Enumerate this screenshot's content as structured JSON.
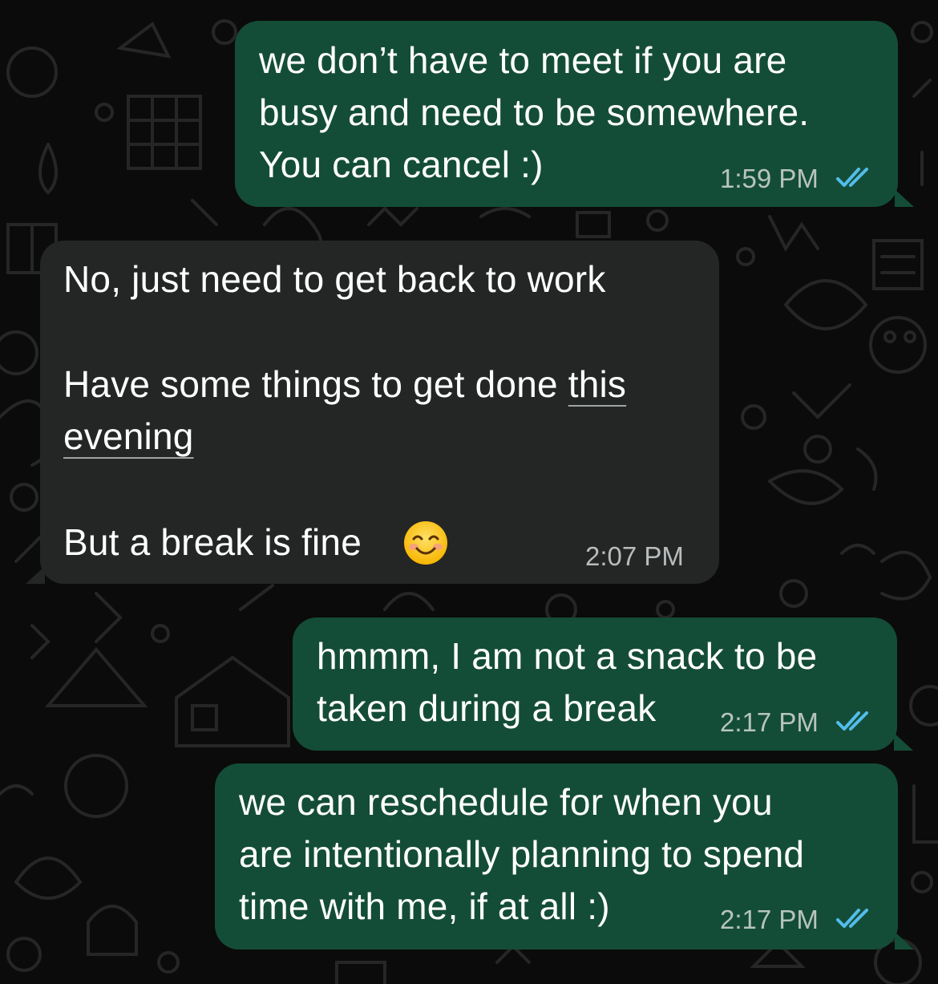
{
  "chat": {
    "messages": [
      {
        "direction": "outgoing",
        "lines": [
          "we don’t have to meet if you are",
          "busy and need to be somewhere.",
          "You can cancel :)"
        ],
        "time": "1:59 PM",
        "read_icon": "double-check-icon"
      },
      {
        "direction": "incoming",
        "line1": "No, just need to get back to work",
        "line2_plain": "Have some things to get done ",
        "line2_link": "this",
        "line3_link": "evening",
        "line4": "But a break is fine",
        "emoji": "smiling-face-emoji",
        "time": "2:07 PM"
      },
      {
        "direction": "outgoing",
        "lines": [
          "hmmm, I am not a snack to be",
          "taken during a break"
        ],
        "time": "2:17 PM",
        "read_icon": "double-check-icon"
      },
      {
        "direction": "outgoing",
        "lines": [
          "we can reschedule for when you",
          "are intentionally planning to spend",
          "time with me, if at all :)"
        ],
        "time": "2:17 PM",
        "read_icon": "double-check-icon"
      }
    ]
  },
  "colors": {
    "background": "#0b0b0b",
    "outgoing_bubble": "#144d37",
    "incoming_bubble": "#242626",
    "read_ticks": "#53bdeb",
    "text": "#ffffff"
  }
}
